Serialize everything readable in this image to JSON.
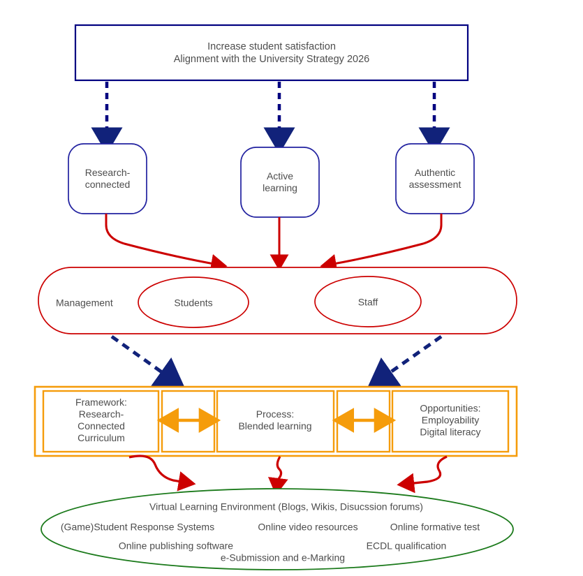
{
  "diagram": {
    "title_box": {
      "line1": "Increase student satisfaction",
      "line2": "Alignment with the University Strategy 2026",
      "border_color": "#000080"
    },
    "pedagogy_nodes": [
      {
        "label": "Research-\nconnected"
      },
      {
        "label": "Active\nlearning"
      },
      {
        "label": "Authentic\nassessment"
      }
    ],
    "stakeholders": {
      "plain_label": "Management",
      "ellipses": [
        {
          "label": "Students"
        },
        {
          "label": "Staff"
        }
      ],
      "border_color": "#CC0000"
    },
    "delivery": {
      "border_color": "#F59C0B",
      "boxes": [
        {
          "label": "Framework:\nResearch-\nConnected\nCurriculum"
        },
        {
          "label": "Process:\nBlended learning"
        },
        {
          "label": "Opportunities:\nEmployability\nDigital literacy"
        }
      ],
      "connectors": [
        "double-arrow",
        "double-arrow"
      ]
    },
    "technology": {
      "border_color": "#1B7A1B",
      "items": [
        {
          "label": "Virtual Learning Environment (Blogs, Wikis, Disucssion forums)"
        },
        {
          "label": "(Game)Student Response Systems"
        },
        {
          "label": "Online video resources"
        },
        {
          "label": "Online formative test"
        },
        {
          "label": "Online publishing software"
        },
        {
          "label": "ECDL qualification"
        },
        {
          "label": "e-Submission and e-Marking"
        }
      ]
    },
    "arrows": {
      "dashed_navy_color": "#000080",
      "red_color": "#CC0000",
      "orange_color": "#F59C0B"
    }
  }
}
